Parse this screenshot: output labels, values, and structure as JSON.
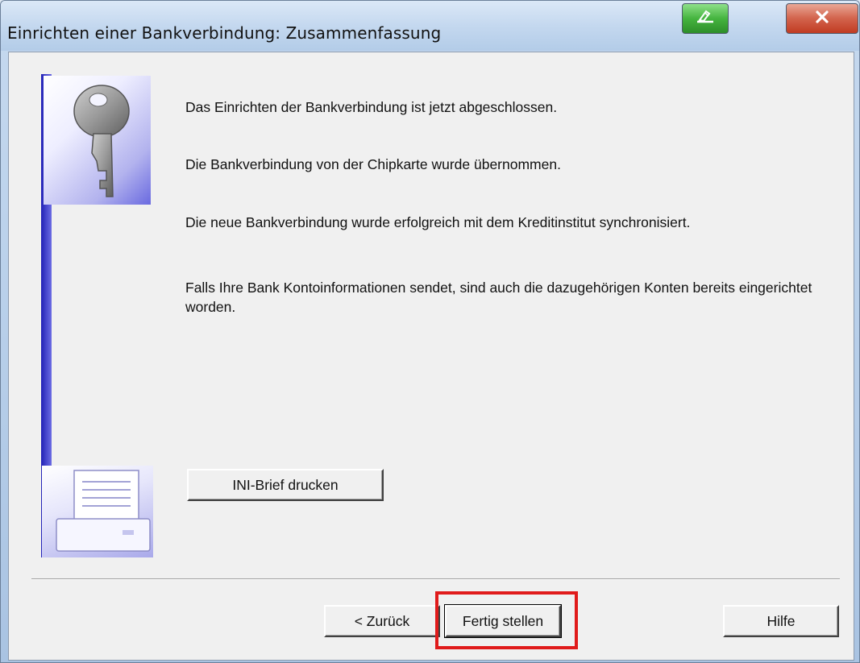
{
  "window": {
    "title": "Einrichten einer Bankverbindung: Zusammenfassung"
  },
  "icons": {
    "key": "key-icon",
    "printer": "printer-icon",
    "signature": "signature-icon",
    "close": "close-icon"
  },
  "content": {
    "messages": [
      "Das Einrichten der Bankverbindung ist jetzt abgeschlossen.",
      "Die Bankverbindung von der Chipkarte wurde übernommen.",
      "Die neue Bankverbindung wurde erfolgreich mit dem Kreditinstitut synchronisiert.",
      "Falls Ihre Bank Kontoinformationen sendet, sind auch die dazugehörigen Konten bereits eingerichtet worden."
    ],
    "ini_button": "INI-Brief drucken"
  },
  "footer": {
    "back": "< Zurück",
    "finish": "Fertig stellen",
    "help": "Hilfe"
  },
  "colors": {
    "sidebar_accent": "#3a3acf",
    "highlight": "#e01b1b"
  }
}
